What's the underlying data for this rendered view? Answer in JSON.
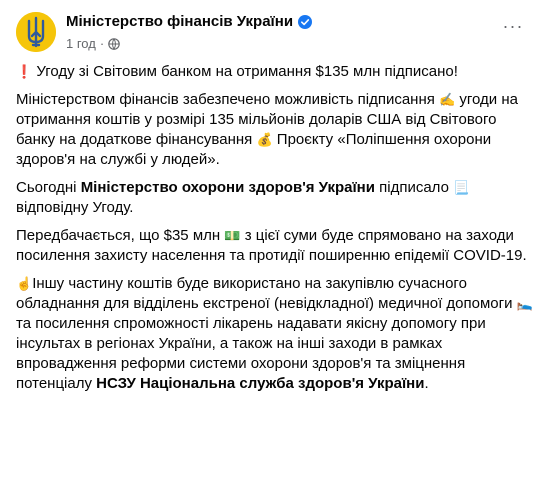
{
  "post": {
    "page_name": "Міністерство фінансів України",
    "time": "1 год",
    "separator": "·",
    "more_label": "···"
  },
  "paragraphs": [
    {
      "emoji_start": "❗",
      "text": " Угоду зі Світовим банком на отримання $135 млн підписано!"
    },
    {
      "text_a": "Міністерством фінансів забезпечено можливість підписання ",
      "emoji_a": "✍",
      "text_b": " угоди на отримання коштів у розмірі 135 мільйонів доларів США від Світового банку на додаткове фінансування ",
      "emoji_b": "💰",
      "text_c": " Проєкту «Поліпшення охорони здоров'я на службі у людей»."
    },
    {
      "text_a": "Сьогодні ",
      "bold": "Міністерство охорони здоров'я України",
      "text_b": " підписало ",
      "emoji": "📃",
      "text_c": " відповідну Угоду."
    },
    {
      "text_a": "Передбачається, що $35 млн ",
      "emoji": "💵",
      "text_b": " з цієї суми буде спрямовано на заходи посилення захисту населення та протидії поширенню епідемії COVID-19."
    },
    {
      "emoji_start": "☝",
      "text_a": "Іншу частину коштів буде використано на закупівлю сучасного обладнання для відділень екстреної (невідкладної) медичної допомоги ",
      "emoji": "🛌",
      "text_b": " та посилення спроможності лікарень надавати якісну допомогу при інсультах в регіонах України, а також на інші заходи в рамках впровадження реформи системи охорони здоров'я та зміцнення потенціалу ",
      "bold": "НСЗУ Національна служба здоров'я України",
      "text_c": "."
    }
  ],
  "colors": {
    "avatar_bg": "#f5c50a",
    "trident": "#2f5a9e",
    "verified": "#1877f2",
    "meta": "#65676b"
  }
}
